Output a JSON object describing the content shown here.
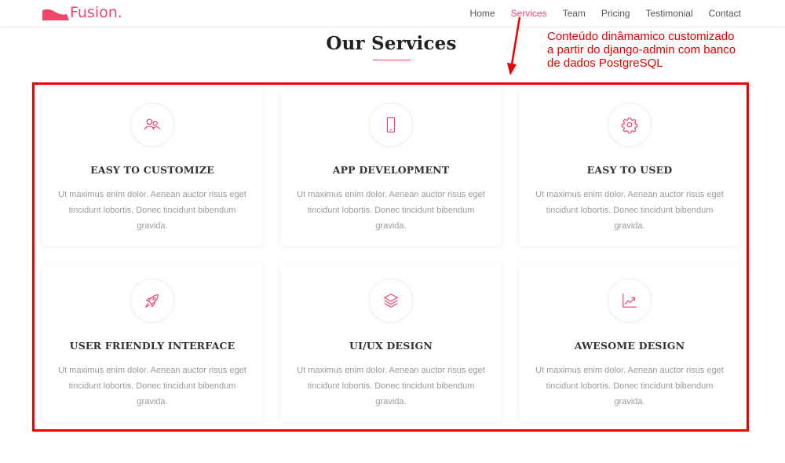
{
  "brand": {
    "name": "Fusion.",
    "accent_color": "#f2456c"
  },
  "nav": {
    "items": [
      {
        "label": "Home",
        "active": false
      },
      {
        "label": "Services",
        "active": true
      },
      {
        "label": "Team",
        "active": false
      },
      {
        "label": "Pricing",
        "active": false
      },
      {
        "label": "Testimonial",
        "active": false
      },
      {
        "label": "Contact",
        "active": false
      }
    ]
  },
  "section": {
    "title": "Our Services"
  },
  "annotation": {
    "lines": [
      "Conteúdo dinâmamico customizado",
      "a partir do django-admin com banco",
      "de dados PostgreSQL"
    ],
    "color": "#e00000"
  },
  "services": [
    {
      "icon": "users-icon",
      "title": "EASY TO CUSTOMIZE",
      "text": "Ut maximus enim dolor. Aenean auctor risus eget tincidunt lobortis. Donec tincidunt bibendum gravida."
    },
    {
      "icon": "mobile-phone-icon",
      "title": "APP DEVELOPMENT",
      "text": "Ut maximus enim dolor. Aenean auctor risus eget tincidunt lobortis. Donec tincidunt bibendum gravida."
    },
    {
      "icon": "gear-icon",
      "title": "EASY TO USED",
      "text": "Ut maximus enim dolor. Aenean auctor risus eget tincidunt lobortis. Donec tincidunt bibendum gravida."
    },
    {
      "icon": "rocket-icon",
      "title": "USER FRIENDLY INTERFACE",
      "text": "Ut maximus enim dolor. Aenean auctor risus eget tincidunt lobortis. Donec tincidunt bibendum gravida."
    },
    {
      "icon": "layers-icon",
      "title": "UI/UX DESIGN",
      "text": "Ut maximus enim dolor. Aenean auctor risus eget tincidunt lobortis. Donec tincidunt bibendum gravida."
    },
    {
      "icon": "trending-chart-icon",
      "title": "AWESOME DESIGN",
      "text": "Ut maximus enim dolor. Aenean auctor risus eget tincidunt lobortis. Donec tincidunt bibendum gravida."
    }
  ]
}
